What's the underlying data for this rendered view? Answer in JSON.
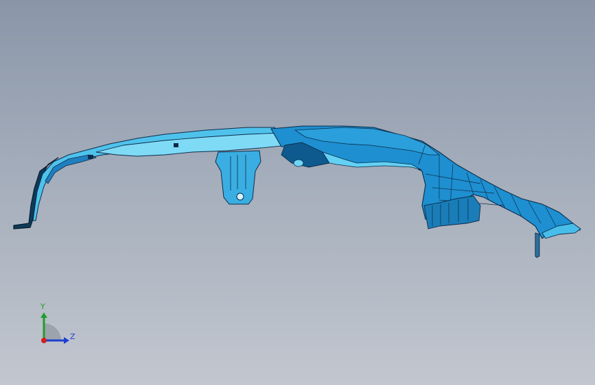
{
  "viewport": {
    "background_top": "#8a96a8",
    "background_bottom": "#c2c7cf"
  },
  "model": {
    "part": "bumper-bracket-part",
    "body_color": "#1e8fd0",
    "highlight_color": "#5fd0f0",
    "edge_color": "#0b2b48"
  },
  "triad": {
    "y_label": "Y",
    "z_label": "Z",
    "y_color": "#1e9e2a",
    "z_color": "#1d3fd1",
    "x_color": "#d41e1e"
  }
}
